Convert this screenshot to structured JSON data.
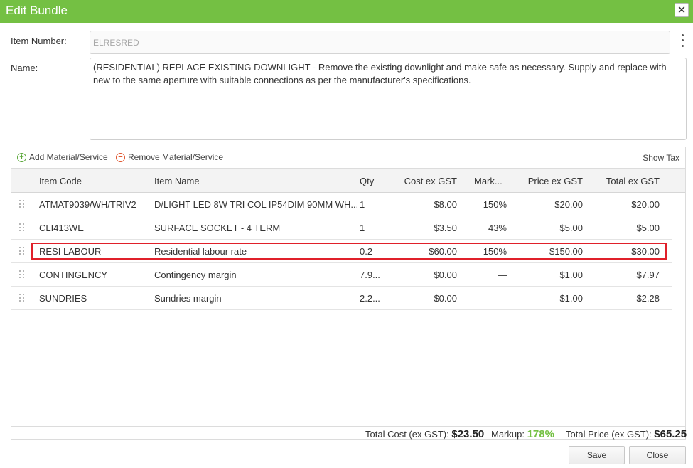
{
  "dialog": {
    "title": "Edit Bundle"
  },
  "form": {
    "item_number_label": "Item Number:",
    "item_number_value": "ELRESRED",
    "name_label": "Name:",
    "name_value": "(RESIDENTIAL) REPLACE EXISTING DOWNLIGHT - Remove the existing downlight and make safe as necessary. Supply and replace with new to the same aperture with suitable connections as per the manufacturer's specifications."
  },
  "toolbar": {
    "add_label": "Add Material/Service",
    "remove_label": "Remove Material/Service",
    "show_tax_label": "Show Tax"
  },
  "table": {
    "columns": [
      "Item Code",
      "Item Name",
      "Qty",
      "Cost ex GST",
      "Mark...",
      "Price ex GST",
      "Total ex GST"
    ],
    "rows": [
      {
        "code": "ATMAT9039/WH/TRIV2",
        "name": "D/LIGHT LED 8W TRI COL IP54DIM 90MM WH...",
        "qty": "1",
        "cost": "$8.00",
        "markup": "150%",
        "price": "$20.00",
        "total": "$20.00"
      },
      {
        "code": "CLI413WE",
        "name": "SURFACE SOCKET - 4 TERM",
        "qty": "1",
        "cost": "$3.50",
        "markup": "43%",
        "price": "$5.00",
        "total": "$5.00"
      },
      {
        "code": "RESI LABOUR",
        "name": "Residential labour rate",
        "qty": "0.2",
        "cost": "$60.00",
        "markup": "150%",
        "price": "$150.00",
        "total": "$30.00"
      },
      {
        "code": "CONTINGENCY",
        "name": "Contingency margin",
        "qty": "7.9...",
        "cost": "$0.00",
        "markup": "—",
        "price": "$1.00",
        "total": "$7.97"
      },
      {
        "code": "SUNDRIES",
        "name": "Sundries margin",
        "qty": "2.2...",
        "cost": "$0.00",
        "markup": "—",
        "price": "$1.00",
        "total": "$2.28"
      }
    ]
  },
  "totals": {
    "cost_label": "Total Cost (ex GST):",
    "cost_value": "$23.50",
    "markup_label": "Markup:",
    "markup_value": "178%",
    "price_label": "Total Price (ex GST):",
    "price_value": "$65.25"
  },
  "buttons": {
    "save": "Save",
    "close": "Close"
  },
  "colors": {
    "title_bar": "#74c043",
    "highlight": "#e0202a",
    "markup_value": "#74c043"
  }
}
